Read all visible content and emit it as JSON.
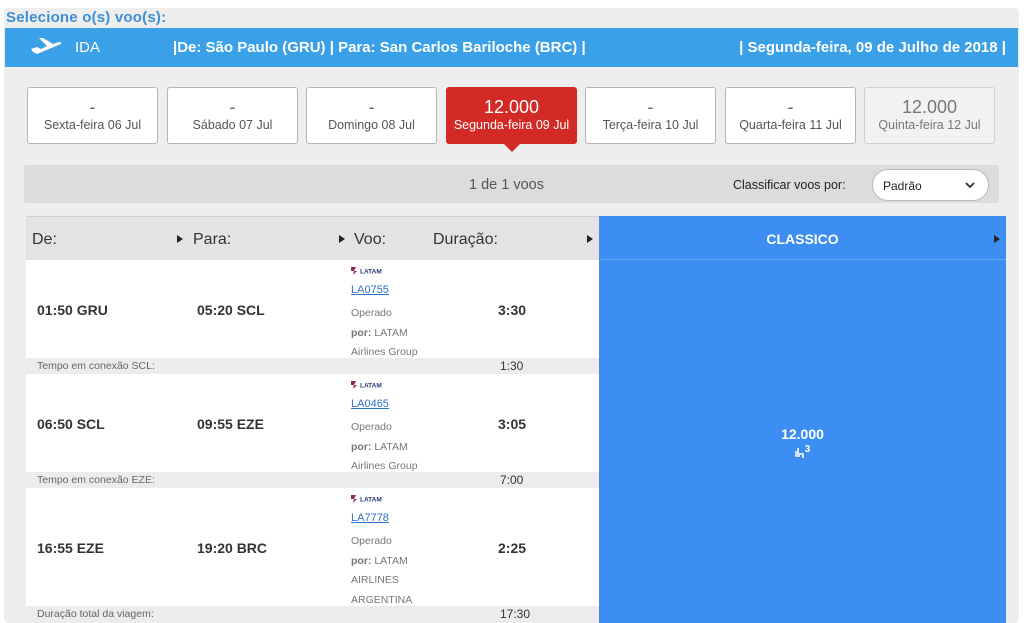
{
  "section_title": "Selecione o(s) voo(s):",
  "header": {
    "direction": "IDA",
    "route": "|De: São Paulo (GRU) | Para: San Carlos Bariloche (BRC) |",
    "date": "| Segunda-feira, 09 de Julho de 2018 |"
  },
  "days": [
    {
      "price": "-",
      "label": "Sexta-feira 06 Jul"
    },
    {
      "price": "-",
      "label": "Sábado 07 Jul"
    },
    {
      "price": "-",
      "label": "Domingo 08 Jul"
    },
    {
      "price": "12.000",
      "label": "Segunda-feira 09 Jul"
    },
    {
      "price": "-",
      "label": "Terça-feira 10 Jul"
    },
    {
      "price": "-",
      "label": "Quarta-feira 11 Jul"
    },
    {
      "price": "12.000",
      "label": "Quinta-feira 12 Jul"
    }
  ],
  "summary": {
    "count": "1 de 1 voos",
    "sort_label": "Classificar voos por:",
    "sort_value": "Padrão"
  },
  "columns": {
    "from": "De:",
    "to": "Para:",
    "flight": "Voo:",
    "duration": "Duração:",
    "fare": "CLASSICO"
  },
  "segments": [
    {
      "dep": "01:50 GRU",
      "arr": "05:20 SCL",
      "airline_logo": "LATAM",
      "flight": "LA0755",
      "operated": "Operado",
      "by": "por:",
      "operator_line1": "LATAM",
      "operator_line2": "Airlines Group",
      "duration": "3:30"
    },
    {
      "dep": "06:50 SCL",
      "arr": "09:55 EZE",
      "airline_logo": "LATAM",
      "flight": "LA0465",
      "operated": "Operado",
      "by": "por:",
      "operator_line1": "LATAM",
      "operator_line2": "Airlines Group",
      "duration": "3:05"
    },
    {
      "dep": "16:55 EZE",
      "arr": "19:20 BRC",
      "airline_logo": "LATAM",
      "flight": "LA7778",
      "operated": "Operado",
      "by": "por:",
      "operator_line1": "LATAM",
      "operator_line2": "AIRLINES",
      "operator_line3": "ARGENTINA",
      "duration": "2:25"
    }
  ],
  "connections": [
    {
      "label": "Tempo em conexão SCL:",
      "value": "1:30"
    },
    {
      "label": "Tempo em conexão EZE:",
      "value": "7:00"
    },
    {
      "label": "Duração total da viagem:",
      "value": "17:30"
    }
  ],
  "fare": {
    "price": "12.000",
    "seats": "3",
    "seat_icon": "seat-icon"
  },
  "colors": {
    "header_blue": "#3aa0e8",
    "fare_blue": "#3d8ef2",
    "selected_red": "#d42a26",
    "title_blue": "#3d8fd8"
  }
}
